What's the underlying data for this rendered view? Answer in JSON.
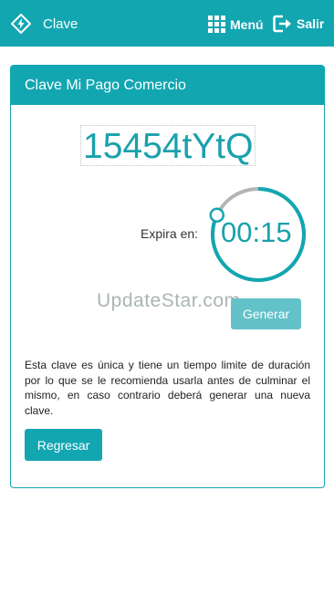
{
  "header": {
    "title": "Clave",
    "logo_icon": "lightning-diamond-icon",
    "menu_label": "Menú",
    "menu_icon": "grid-icon",
    "exit_label": "Salir",
    "exit_icon": "exit-icon"
  },
  "card": {
    "title": "Clave Mi Pago Comercio",
    "code": "15454tYtQ",
    "expires_label": "Expira en:",
    "timer": "00:15",
    "timer_progress": 0.82,
    "watermark": "UpdateStar.com",
    "generate_label": "Generar",
    "info_text": "Esta clave es única y tiene un tiempo limite de duración por lo que se le recomienda usarla antes de culminar el mismo, en caso contrario deberá generar una nueva clave.",
    "back_label": "Regresar"
  },
  "colors": {
    "primary": "#12a6b1",
    "disabled_button": "#62c2c8",
    "ring_track": "#b5b5b5"
  }
}
